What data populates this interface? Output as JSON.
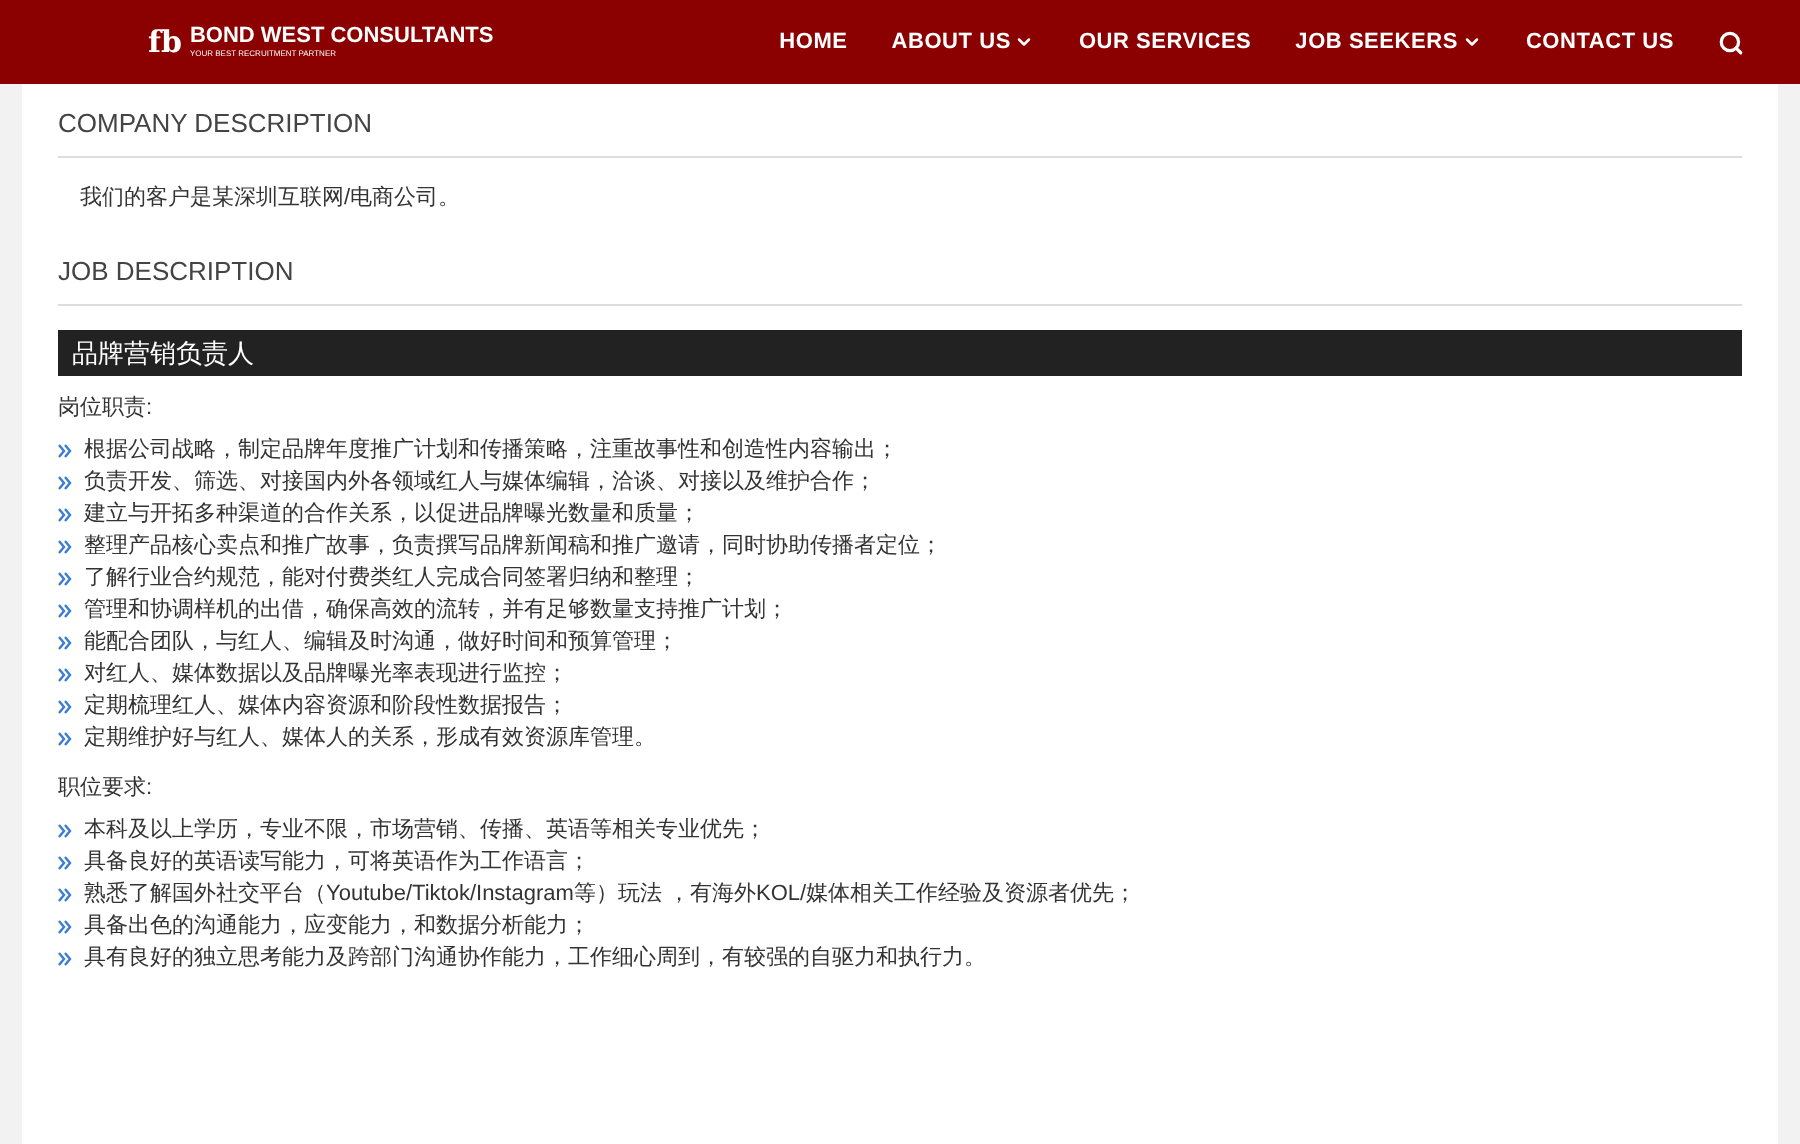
{
  "header": {
    "logo_mark": "fb",
    "brand": "BOND WEST CONSULTANTS",
    "tagline": "YOUR BEST RECRUITMENT PARTNER",
    "nav": [
      {
        "label": "HOME",
        "dropdown": false
      },
      {
        "label": "ABOUT US",
        "dropdown": true
      },
      {
        "label": "OUR SERVICES",
        "dropdown": false
      },
      {
        "label": "JOB SEEKERS",
        "dropdown": true
      },
      {
        "label": "CONTACT US",
        "dropdown": false
      }
    ]
  },
  "company_description": {
    "heading": "COMPANY DESCRIPTION",
    "text": "我们的客户是某深圳互联网/电商公司。"
  },
  "job_description": {
    "heading": "JOB DESCRIPTION",
    "job_title": "品牌营销负责人",
    "sections": [
      {
        "heading": "岗位职责:",
        "items": [
          "根据公司战略，制定品牌年度推广计划和传播策略，注重故事性和创造性内容输出；",
          "负责开发、筛选、对接国内外各领域红人与媒体编辑，洽谈、对接以及维护合作；",
          "建立与开拓多种渠道的合作关系，以促进品牌曝光数量和质量；",
          "整理产品核心卖点和推广故事，负责撰写品牌新闻稿和推广邀请，同时协助传播者定位；",
          "了解行业合约规范，能对付费类红人完成合同签署归纳和整理；",
          "管理和协调样机的出借，确保高效的流转，并有足够数量支持推广计划；",
          "能配合团队，与红人、编辑及时沟通，做好时间和预算管理；",
          "对红人、媒体数据以及品牌曝光率表现进行监控；",
          "定期梳理红人、媒体内容资源和阶段性数据报告；",
          "定期维护好与红人、媒体人的关系，形成有效资源库管理。"
        ]
      },
      {
        "heading": "职位要求:",
        "items": [
          "本科及以上学历，专业不限，市场营销、传播、英语等相关专业优先；",
          "具备良好的英语读写能力，可将英语作为工作语言；",
          "熟悉了解国外社交平台（Youtube/Tiktok/Instagram等）玩法 ，有海外KOL/媒体相关工作经验及资源者优先；",
          "具备出色的沟通能力，应变能力，和数据分析能力；",
          "具有良好的独立思考能力及跨部门沟通协作能力，工作细心周到，有较强的自驱力和执行力。"
        ]
      }
    ]
  }
}
